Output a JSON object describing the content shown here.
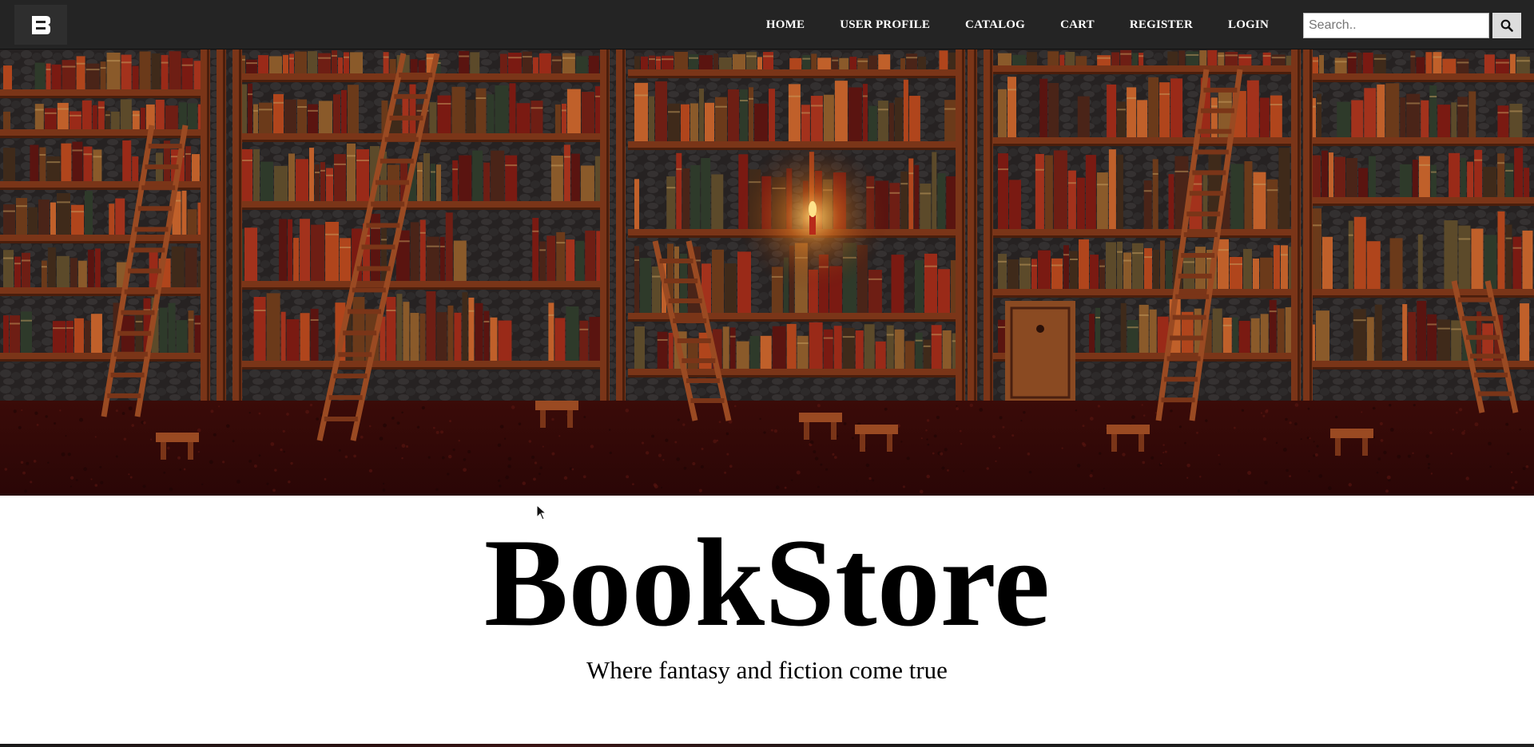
{
  "navbar": {
    "logo_icon": "bookstore-b-logo-icon",
    "links": [
      "HOME",
      "USER PROFILE",
      "CATALOG",
      "CART",
      "REGISTER",
      "LOGIN"
    ],
    "search": {
      "placeholder": "Search..",
      "value": "",
      "button_icon": "search-icon"
    }
  },
  "hero": {
    "image": "library-bookshelves-with-ladders-banner"
  },
  "headline": {
    "title": "BookStore",
    "tagline": "Where fantasy and fiction come true"
  },
  "colors": {
    "navbar_bg": "#242424",
    "nav_text": "#ffffff",
    "hero_wood": "#7a3518",
    "hero_floor": "#3a0e0a",
    "title_text": "#000000"
  }
}
